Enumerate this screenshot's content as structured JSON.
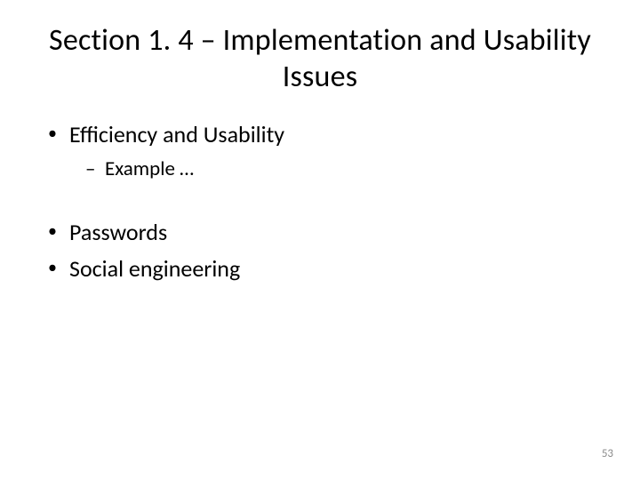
{
  "title": "Section 1. 4 – Implementation and Usability Issues",
  "bullets": {
    "b1": "Efficiency and Usability",
    "b1_sub1": "Example …",
    "b2": "Passwords",
    "b3": "Social engineering"
  },
  "page_number": "53"
}
